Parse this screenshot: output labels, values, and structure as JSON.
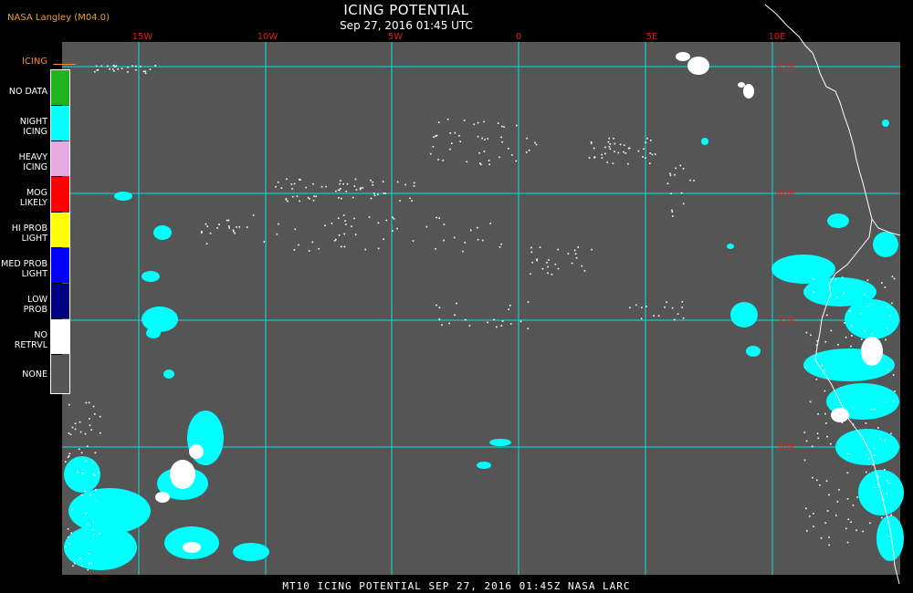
{
  "header": {
    "credit": "NASA Langley (M04.0)",
    "title": "ICING POTENTIAL",
    "subtitle": "Sep 27, 2016 01:45 UTC"
  },
  "longitude_labels": [
    "15W",
    "10W",
    "5W",
    "0",
    "5E",
    "10E"
  ],
  "latitude_labels": [
    "45N",
    "40N",
    "35N",
    "30N"
  ],
  "legend": {
    "title": "ICING",
    "items": [
      {
        "label": "NO DATA",
        "color": "#1db31d"
      },
      {
        "label": "NIGHT ICING",
        "color": "#00ffff"
      },
      {
        "label": "HEAVY ICING",
        "color": "#e8a8e0"
      },
      {
        "label": "MOG LIKELY",
        "color": "#ff0000"
      },
      {
        "label": "HI PROB LIGHT",
        "color": "#ffff00"
      },
      {
        "label": "MED PROB LIGHT",
        "color": "#0000ff"
      },
      {
        "label": "LOW PROB",
        "color": "#000080"
      },
      {
        "label": "NO RETRVL",
        "color": "#ffffff"
      },
      {
        "label": "NONE",
        "color": "#555555"
      }
    ]
  },
  "colors": {
    "background": "#555555",
    "grid": "#00e5e5",
    "night_icing": "#00ffff",
    "no_retrieval": "#ffffff",
    "label": "#d82020"
  },
  "footer": "MT10  ICING POTENTIAL   SEP 27, 2016 01:45Z   NASA LARC"
}
